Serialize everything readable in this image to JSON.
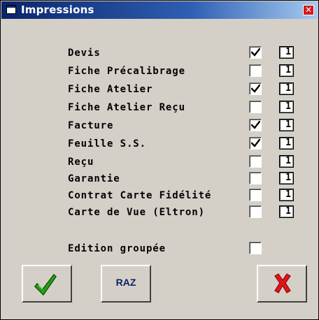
{
  "window": {
    "title": "Impressions"
  },
  "rows": [
    {
      "label": "Devis",
      "checked": true,
      "qty": "1"
    },
    {
      "label": "Fiche Précalibrage",
      "checked": false,
      "qty": "1"
    },
    {
      "label": "Fiche Atelier",
      "checked": true,
      "qty": "1"
    },
    {
      "label": "Fiche Atelier Reçu",
      "checked": false,
      "qty": "1"
    },
    {
      "label": "Facture",
      "checked": true,
      "qty": "1"
    },
    {
      "label": "Feuille S.S.",
      "checked": true,
      "qty": "1"
    },
    {
      "label": "Reçu",
      "checked": false,
      "qty": "1"
    },
    {
      "label": "Garantie",
      "checked": false,
      "qty": "1"
    },
    {
      "label": "Contrat Carte Fidélité",
      "checked": false,
      "qty": "1"
    },
    {
      "label": "Carte de Vue (Eltron)",
      "checked": false,
      "qty": "1"
    }
  ],
  "grouped": {
    "label": "Edition groupée",
    "checked": false
  },
  "buttons": {
    "raz_label": "RAZ"
  },
  "colors": {
    "titlebar": "#0a246a",
    "close": "#d41c1c",
    "ok_green": "#2a9d1a",
    "cancel_red": "#e3141b"
  },
  "icons": {
    "window": "window-icon",
    "close": "close-icon",
    "ok": "check-icon",
    "cancel": "cross-icon"
  }
}
